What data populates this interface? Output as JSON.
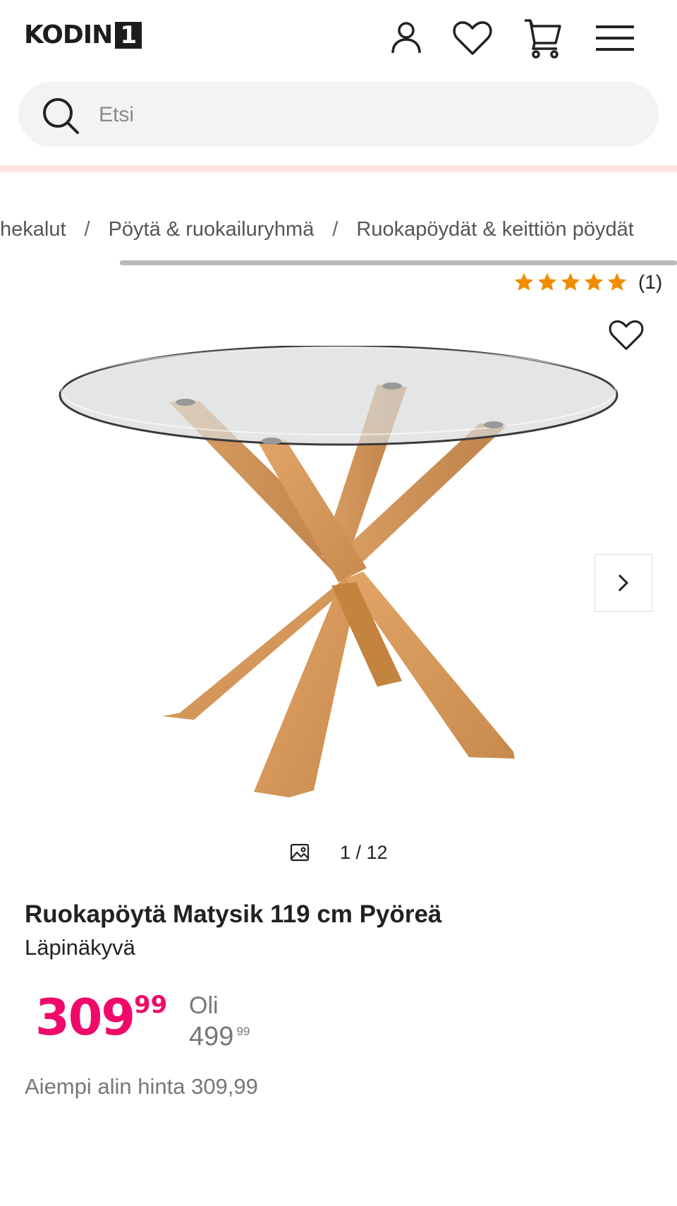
{
  "header": {
    "logo_text": "KODIN",
    "logo_number": "1",
    "icons": [
      "user-icon",
      "heart-icon",
      "cart-icon",
      "menu-icon"
    ]
  },
  "search": {
    "placeholder": "Etsi"
  },
  "breadcrumb": [
    {
      "label": "hekalut"
    },
    {
      "label": "Pöytä & ruokailuryhmä"
    },
    {
      "label": "Ruokapöydät & keittiön pöydät"
    }
  ],
  "breadcrumb_separator": "/",
  "rating": {
    "stars": 5,
    "count_label": "(1)",
    "star_color": "#f08c00"
  },
  "gallery": {
    "counter": "1 / 12",
    "icons": [
      "image-icon",
      "chevron-right-icon",
      "heart-icon"
    ]
  },
  "product": {
    "title": "Ruokapöytä Matysik 119 cm Pyöreä",
    "variant": "Läpinäkyvä",
    "price_main": "309",
    "price_cents": "99",
    "old_label": "Oli",
    "old_price_main": "499",
    "old_price_cents": "99",
    "lowest_price": "Aiempi alin hinta 309,99"
  },
  "colors": {
    "accent": "#ef0a6a",
    "muted": "#777777",
    "pink_bar": "#fde3e4"
  }
}
